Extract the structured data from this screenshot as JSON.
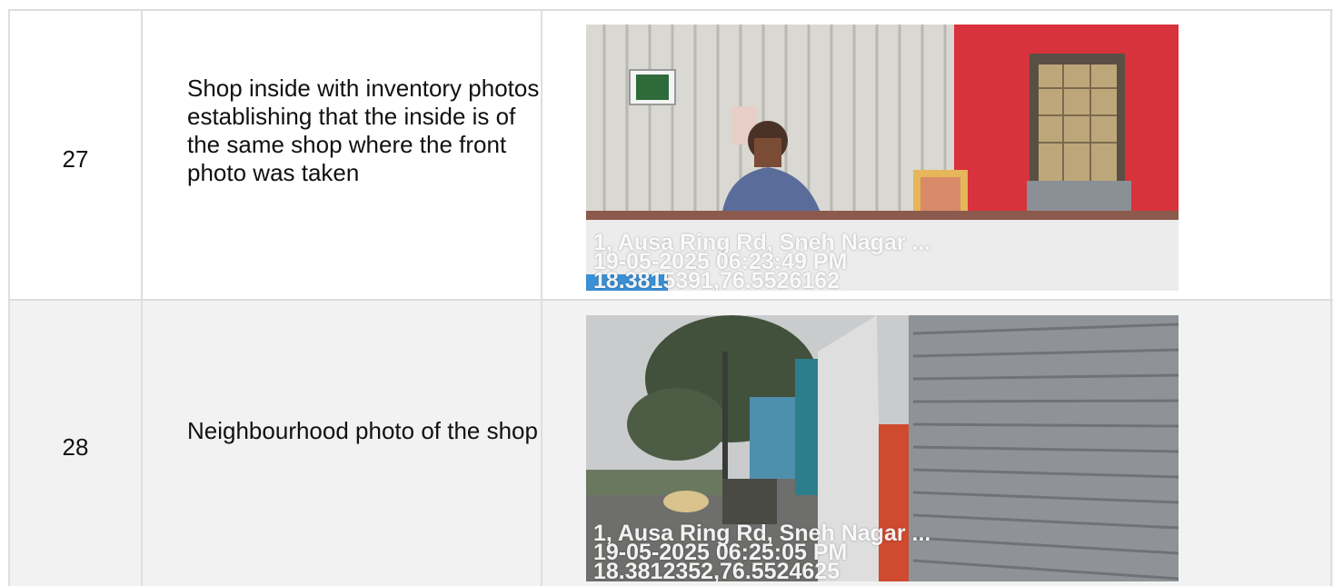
{
  "rows": [
    {
      "number": "27",
      "description": "Shop inside with inventory photos establishing that the inside is of the same shop where the front photo was taken",
      "photo": {
        "address": "1, Ausa Ring Rd, Sneh Nagar ...",
        "datetime": "19-05-2025 06:23:49 PM",
        "coordinates": "18.3815391,76.5526162"
      }
    },
    {
      "number": "28",
      "description": "Neighbourhood photo of the shop",
      "photo": {
        "address": "1, Ausa Ring Rd, Sneh Nagar ...",
        "datetime": "19-05-2025 06:25:05 PM",
        "coordinates": "18.3812352,76.5524625"
      }
    }
  ],
  "colors": {
    "border": "#dedede",
    "alt_row_bg": "#f2f2f2",
    "wall_red": "#d8323c",
    "shutter_grey": "#8f9296"
  }
}
